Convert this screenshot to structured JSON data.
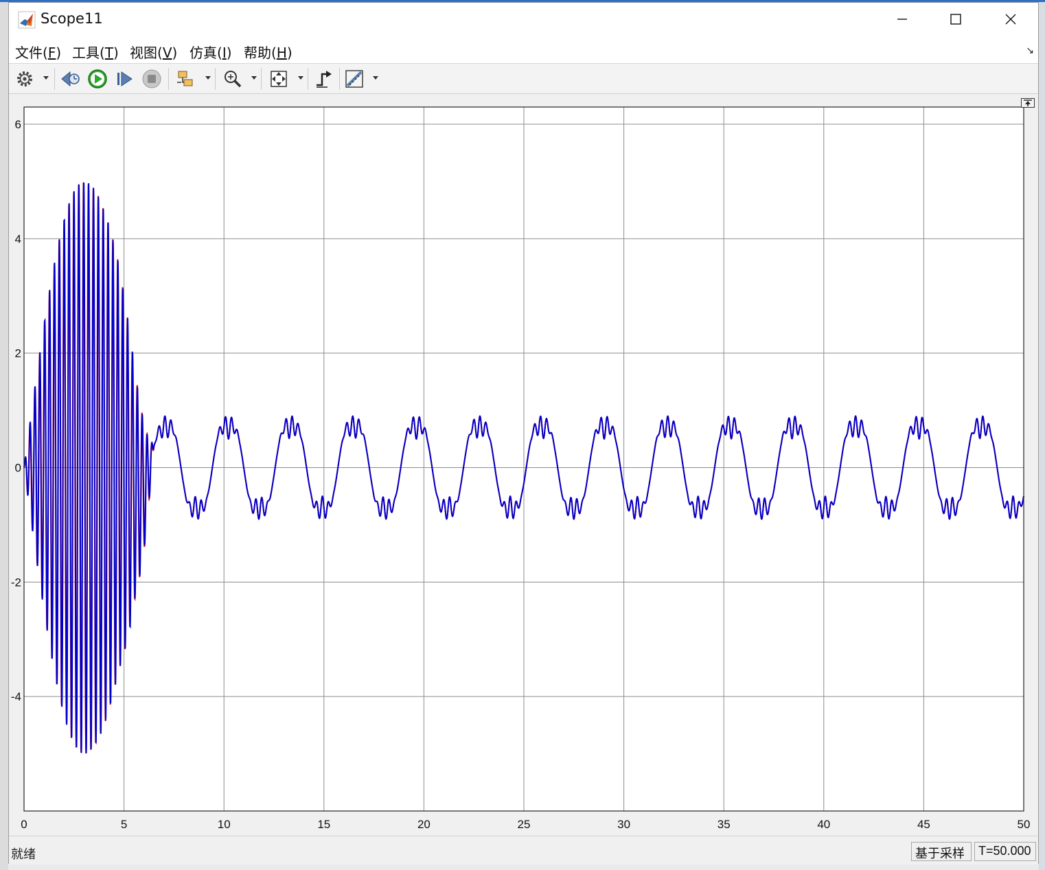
{
  "window": {
    "title": "Scope11",
    "controls": [
      "minimize",
      "maximize",
      "close"
    ]
  },
  "menubar": {
    "items": [
      {
        "label": "文件(",
        "key": "F",
        "tail": ")"
      },
      {
        "label": "工具(",
        "key": "T",
        "tail": ")"
      },
      {
        "label": "视图(",
        "key": "V",
        "tail": ")"
      },
      {
        "label": "仿真(",
        "key": "I",
        "tail": ")"
      },
      {
        "label": "帮助(",
        "key": "H",
        "tail": ")"
      }
    ]
  },
  "toolbar": {
    "buttons": [
      {
        "name": "settings-button",
        "icon": "gear-icon",
        "dropdown": true
      },
      {
        "name": "step-back-button",
        "icon": "step-back-icon",
        "dropdown": false
      },
      {
        "name": "run-button",
        "icon": "play-icon",
        "dropdown": false
      },
      {
        "name": "step-forward-button",
        "icon": "step-forward-icon",
        "dropdown": false
      },
      {
        "name": "stop-button",
        "icon": "stop-icon",
        "dropdown": false
      },
      {
        "name": "highlight-button",
        "icon": "highlight-block-icon",
        "dropdown": true
      },
      {
        "name": "zoom-button",
        "icon": "zoom-in-icon",
        "dropdown": true
      },
      {
        "name": "autoscale-button",
        "icon": "fit-to-view-icon",
        "dropdown": true
      },
      {
        "name": "trigger-button",
        "icon": "trigger-icon",
        "dropdown": false
      },
      {
        "name": "measure-button",
        "icon": "ruler-icon",
        "dropdown": true
      }
    ]
  },
  "colors": {
    "series_blue": "#0000cc",
    "series_red": "#dd0000",
    "grid": "#8c8c8c",
    "background": "#ffffff"
  },
  "chart_data": {
    "type": "line",
    "title": "",
    "xlabel": "",
    "ylabel": "",
    "xlim": [
      0,
      50
    ],
    "ylim": [
      -6,
      6.3
    ],
    "xticks": [
      0,
      5,
      10,
      15,
      20,
      25,
      30,
      35,
      40,
      45,
      50
    ],
    "yticks": [
      6,
      4,
      2,
      0,
      -2,
      -4
    ],
    "ytick_labels": [
      "6",
      "4",
      "2",
      "0",
      "-2",
      "-4"
    ],
    "grid": true,
    "legend": "none",
    "series": [
      {
        "color": "#dd0000",
        "description_points": [
          {
            "x": 0,
            "y": 0
          },
          {
            "x": 0.5,
            "y": 1.0
          },
          {
            "x": 1.0,
            "y": 2.5
          },
          {
            "x": 1.5,
            "y": 3.5
          },
          {
            "x": 2.0,
            "y": 4.3
          },
          {
            "x": 2.5,
            "y": 4.8
          },
          {
            "x": 3.0,
            "y": 5.0
          },
          {
            "x": 3.5,
            "y": 4.0
          },
          {
            "x": 4.0,
            "y": 3.6
          },
          {
            "x": 4.5,
            "y": 2.5
          },
          {
            "x": 5.0,
            "y": 1.5
          },
          {
            "x": 6.0,
            "y": 0.8
          }
        ]
      },
      {
        "color": "#0000cc",
        "steady_period": 3.14,
        "steady_amplitude": 1.0,
        "steady_ripple_amplitude": 0.2,
        "transient_end": 6.5,
        "transient_peak": 5.0,
        "transient_peak_time": 3.0,
        "transient_min": -4.7
      }
    ]
  },
  "status": {
    "text": "就绪",
    "mode": "基于采样",
    "time": "T=50.000"
  }
}
